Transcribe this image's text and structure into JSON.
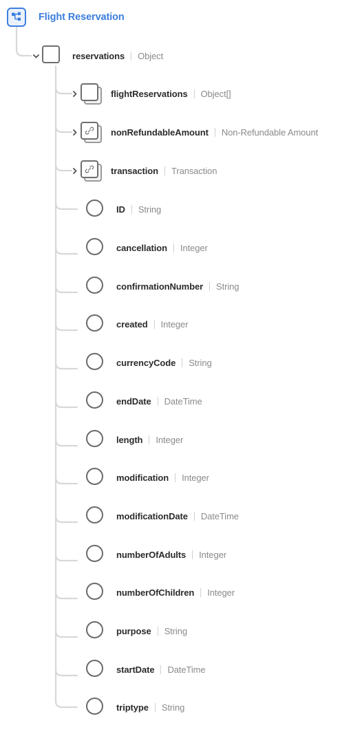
{
  "header": {
    "icon": "sitemap-icon",
    "title": "Flight Reservation",
    "accent_color": "#3b7ddd"
  },
  "tree": {
    "root": {
      "name": "reservations",
      "type": "Object",
      "node_glyph": "square",
      "expander": "chevron-down-icon",
      "expanded": true
    },
    "children": [
      {
        "name": "flightReservations",
        "type": "Object[]",
        "node_glyph": "stacked-square",
        "expander": "chevron-right-icon",
        "expanded": false
      },
      {
        "name": "nonRefundableAmount",
        "type": "Non-Refundable Amount",
        "node_glyph": "stacked-square-link",
        "expander": "chevron-right-icon",
        "expanded": false
      },
      {
        "name": "transaction",
        "type": "Transaction",
        "node_glyph": "stacked-square-link",
        "expander": "chevron-right-icon",
        "expanded": false
      },
      {
        "name": "ID",
        "type": "String",
        "node_glyph": "circle",
        "expander": "none",
        "expanded": false
      },
      {
        "name": "cancellation",
        "type": "Integer",
        "node_glyph": "circle",
        "expander": "none",
        "expanded": false
      },
      {
        "name": "confirmationNumber",
        "type": "String",
        "node_glyph": "circle",
        "expander": "none",
        "expanded": false
      },
      {
        "name": "created",
        "type": "Integer",
        "node_glyph": "circle",
        "expander": "none",
        "expanded": false
      },
      {
        "name": "currencyCode",
        "type": "String",
        "node_glyph": "circle",
        "expander": "none",
        "expanded": false
      },
      {
        "name": "endDate",
        "type": "DateTime",
        "node_glyph": "circle",
        "expander": "none",
        "expanded": false
      },
      {
        "name": "length",
        "type": "Integer",
        "node_glyph": "circle",
        "expander": "none",
        "expanded": false
      },
      {
        "name": "modification",
        "type": "Integer",
        "node_glyph": "circle",
        "expander": "none",
        "expanded": false
      },
      {
        "name": "modificationDate",
        "type": "DateTime",
        "node_glyph": "circle",
        "expander": "none",
        "expanded": false
      },
      {
        "name": "numberOfAdults",
        "type": "Integer",
        "node_glyph": "circle",
        "expander": "none",
        "expanded": false
      },
      {
        "name": "numberOfChildren",
        "type": "Integer",
        "node_glyph": "circle",
        "expander": "none",
        "expanded": false
      },
      {
        "name": "purpose",
        "type": "String",
        "node_glyph": "circle",
        "expander": "none",
        "expanded": false
      },
      {
        "name": "startDate",
        "type": "DateTime",
        "node_glyph": "circle",
        "expander": "none",
        "expanded": false
      },
      {
        "name": "triptype",
        "type": "String",
        "node_glyph": "circle",
        "expander": "none",
        "expanded": false
      }
    ]
  },
  "colors": {
    "connector": "#d8d8d8",
    "node_stroke": "#6a6a6a",
    "name_text": "#2b2b2b",
    "type_text": "#8a8a8a"
  }
}
